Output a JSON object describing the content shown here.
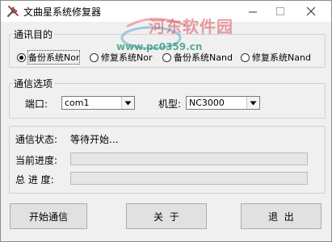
{
  "window": {
    "title": "文曲星系统修复器",
    "icons": {
      "app": "wrench-icon",
      "minimize": "minimize-icon",
      "maximize": "maximize-icon",
      "close": "close-icon"
    }
  },
  "watermark": {
    "title": "河东软件园",
    "url": "www.pc0359.cn"
  },
  "purpose_group": {
    "legend": "通讯目的",
    "options": [
      {
        "label": "备份系统Nor",
        "selected": true
      },
      {
        "label": "修复系统Nor",
        "selected": false
      },
      {
        "label": "备份系统Nand",
        "selected": false
      },
      {
        "label": "修复系统Nand",
        "selected": false
      }
    ]
  },
  "comm_group": {
    "legend": "通信选项",
    "port_label": "端口:",
    "port_value": "com1",
    "model_label": "机型:",
    "model_value": "NC3000"
  },
  "status_group": {
    "status_label": "通信状态:",
    "status_text": "等待开始...",
    "current_label": "当前进度:",
    "current_progress": 0,
    "total_label": "总 进 度:",
    "total_progress": 0
  },
  "buttons": {
    "start": "开始通信",
    "about": "关  于",
    "exit": "退  出"
  }
}
